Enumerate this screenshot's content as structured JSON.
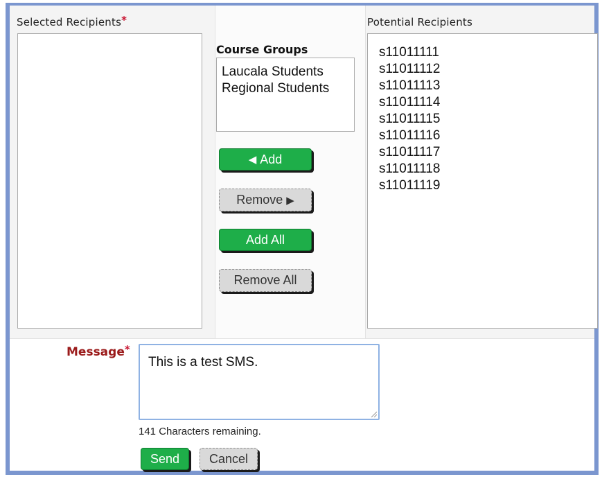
{
  "selected_recipients": {
    "label": "Selected Recipients",
    "required_mark": "*",
    "items": []
  },
  "course_groups": {
    "label": "Course Groups",
    "items": [
      "Laucala Students",
      "Regional Students"
    ]
  },
  "potential_recipients": {
    "label": "Potential Recipients",
    "items": [
      "s11011111",
      "s11011112",
      "s11011113",
      "s11011114",
      "s11011115",
      "s11011116",
      "s11011117",
      "s11011118",
      "s11011119"
    ]
  },
  "buttons": {
    "add": "Add",
    "remove": "Remove",
    "add_all": "Add All",
    "remove_all": "Remove All",
    "send": "Send",
    "cancel": "Cancel"
  },
  "message": {
    "label": "Message",
    "required_mark": "*",
    "value": "This is a test SMS.",
    "remaining_text": "141 Characters remaining."
  },
  "colors": {
    "frame": "#7b96cf",
    "green_button": "#1eae49",
    "gray_button": "#d9d9d9",
    "required": "#c8102e",
    "message_label": "#9b1b1b"
  }
}
